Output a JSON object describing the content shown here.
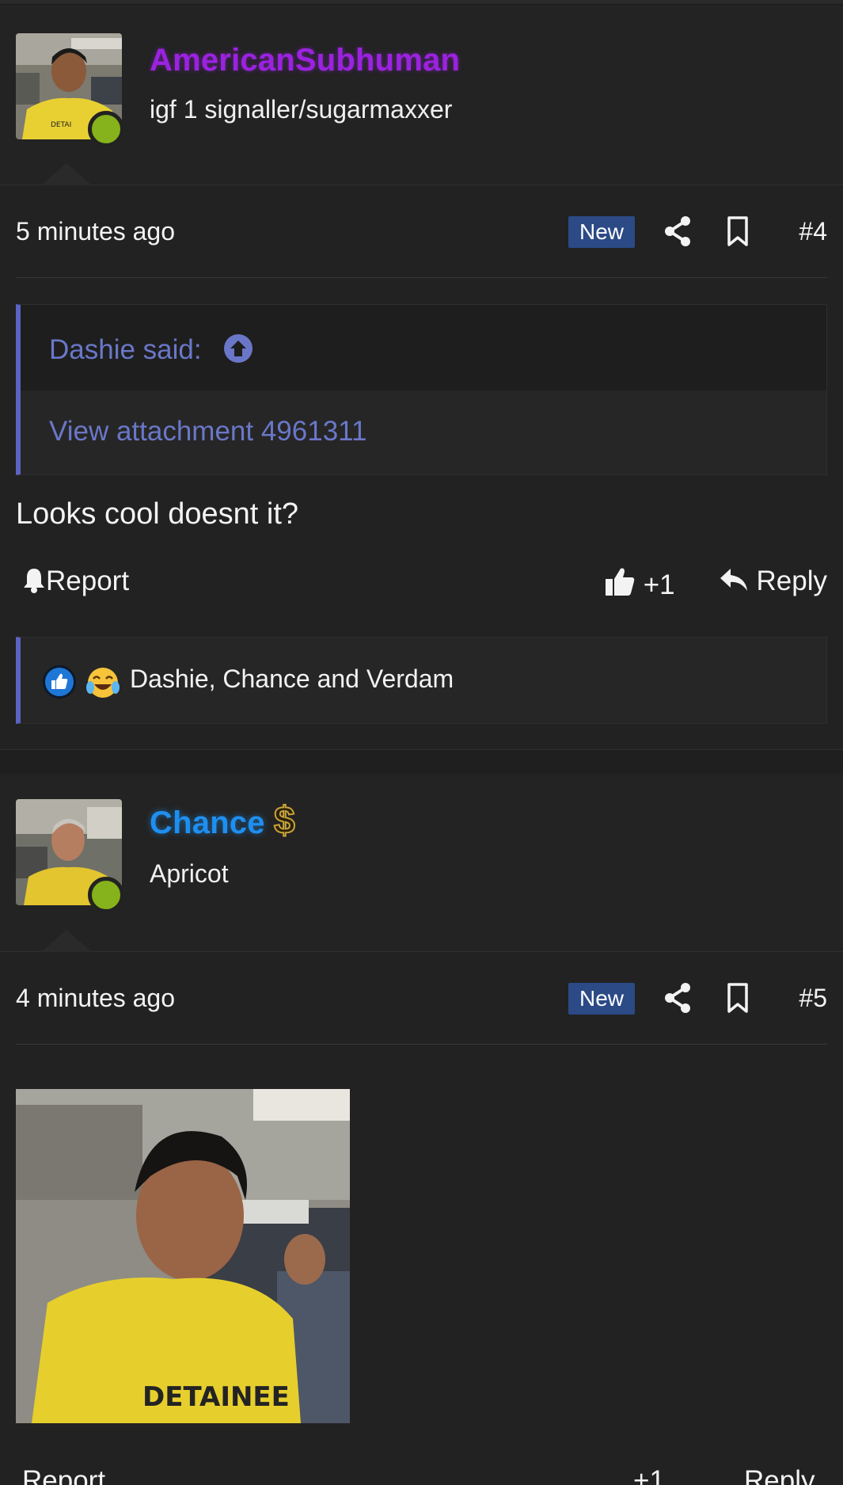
{
  "posts": [
    {
      "username": "AmericanSubhuman",
      "user_title": "igf 1 signaller/sugarmaxxer",
      "time": "5 minutes ago",
      "badge": "New",
      "post_number": "#4",
      "quote": {
        "author_line": "Dashie said:",
        "body": "View attachment 4961311"
      },
      "message": "Looks cool doesnt it?",
      "actions": {
        "report": "Report",
        "like": "+1",
        "reply": "Reply"
      },
      "reactions": {
        "names": "Dashie, Chance and Verdam",
        "icons": [
          "like-icon",
          "laughing-crying-emoji"
        ]
      }
    },
    {
      "username": "Chance",
      "user_title": "Apricot",
      "time": "4 minutes ago",
      "badge": "New",
      "post_number": "#5",
      "actions": {
        "report": "Report",
        "like": "+1",
        "reply": "Reply"
      }
    }
  ],
  "colors": {
    "background": "#222222",
    "username_purple": "#9b22e0",
    "username_blue": "#1e8ff0",
    "accent_quote": "#5b63c4",
    "badge_new": "#2b4a86",
    "online": "#86b21b"
  }
}
